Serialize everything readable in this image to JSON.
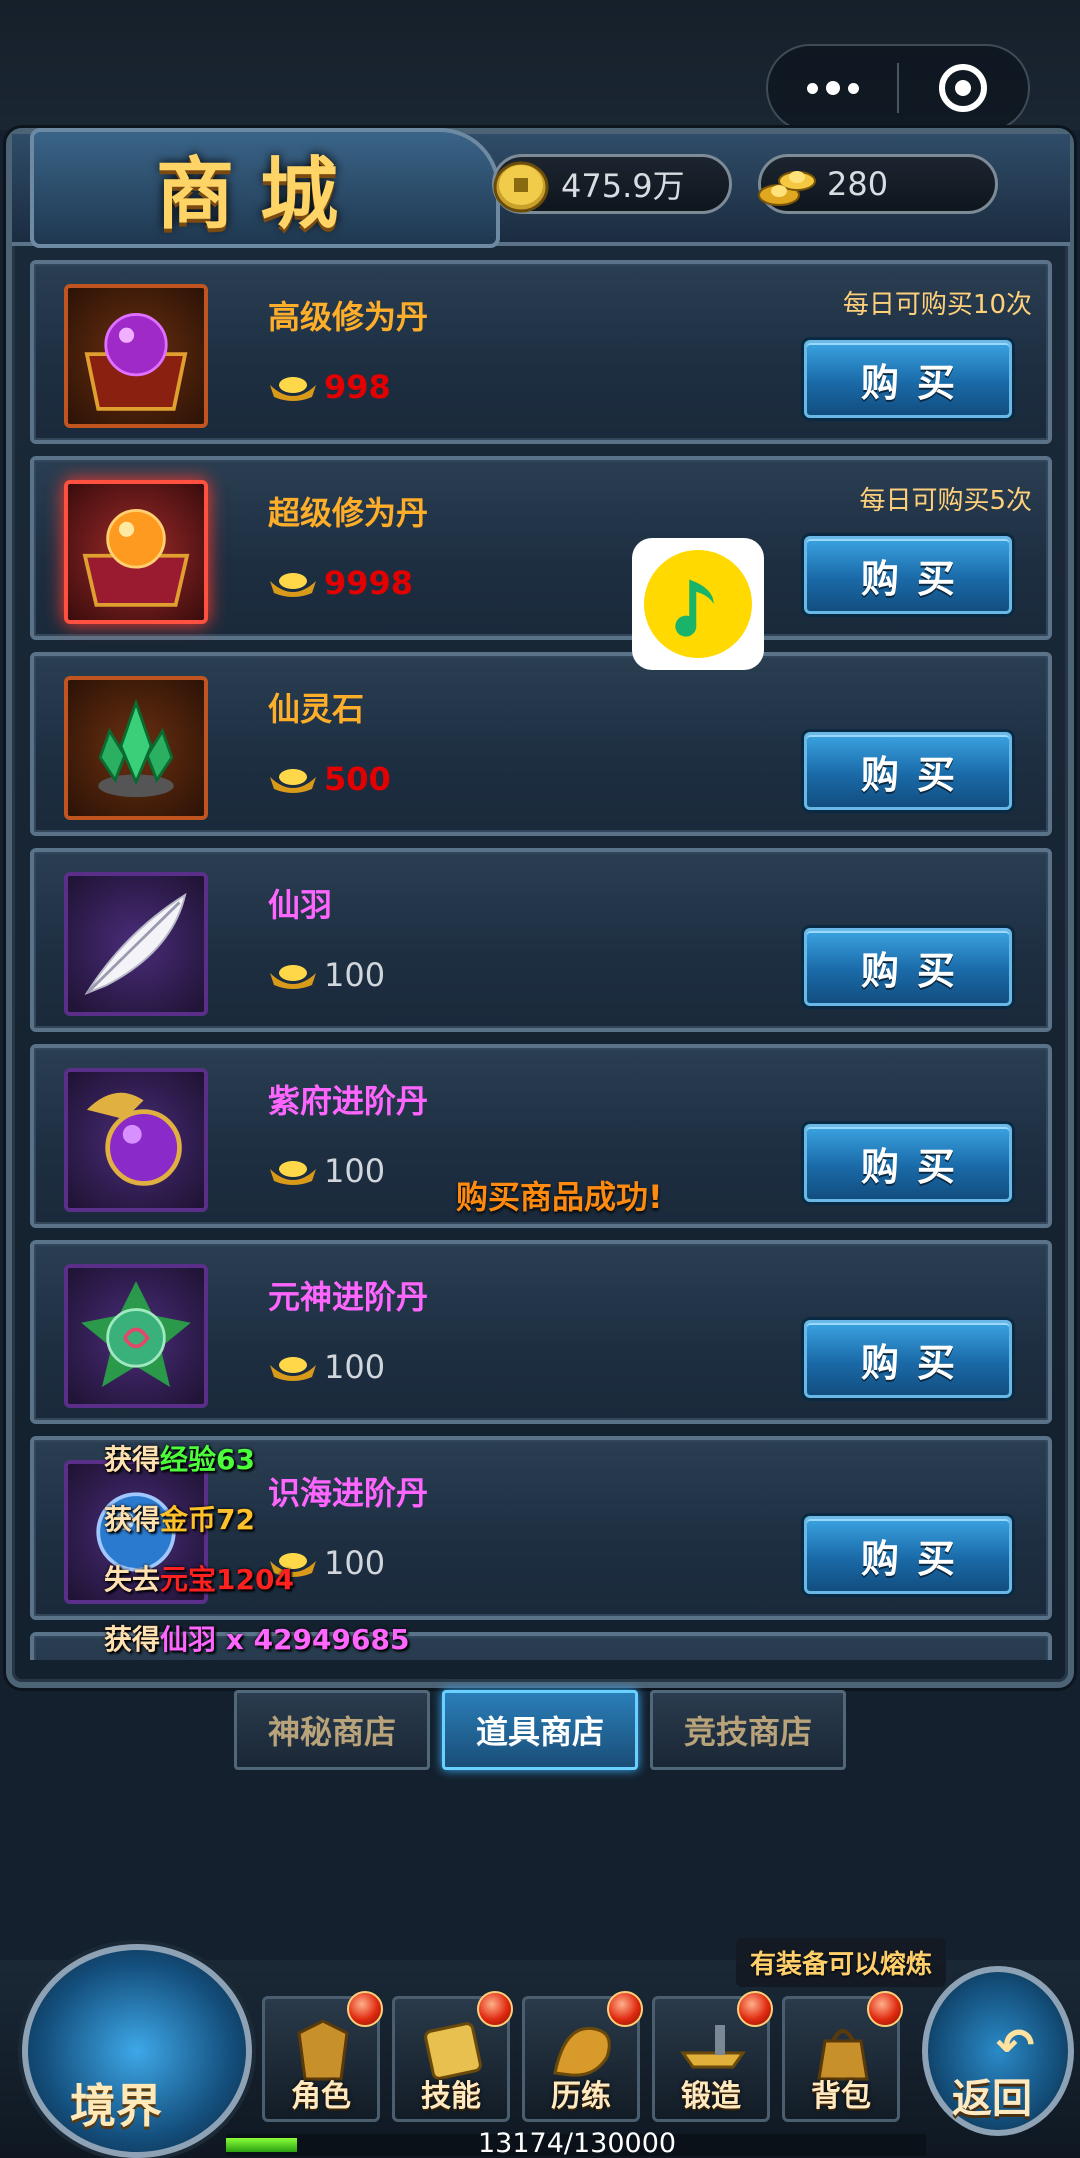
{
  "header": {
    "title": "商城",
    "copper": "475.9万",
    "gold": "280"
  },
  "items": [
    {
      "name": "高级修为丹",
      "price": "998",
      "limit": "每日可购买10次",
      "buy": "购买"
    },
    {
      "name": "超级修为丹",
      "price": "9998",
      "limit": "每日可购买5次",
      "buy": "购买"
    },
    {
      "name": "仙灵石",
      "price": "500",
      "buy": "购买"
    },
    {
      "name": "仙羽",
      "price": "100",
      "buy": "购买"
    },
    {
      "name": "紫府进阶丹",
      "price": "100",
      "buy": "购买"
    },
    {
      "name": "元神进阶丹",
      "price": "100",
      "buy": "购买"
    },
    {
      "name": "识海进阶丹",
      "price": "100",
      "buy": "购买"
    }
  ],
  "toast": "购买商品成功!",
  "log": [
    {
      "prefix": "获得",
      "text": "经验63"
    },
    {
      "prefix": "获得",
      "text": "金币72"
    },
    {
      "prefix": "失去",
      "text": "元宝1204"
    },
    {
      "prefix": "获得",
      "text": "仙羽 x 42949685"
    }
  ],
  "tabs": [
    "神秘商店",
    "道具商店",
    "竞技商店"
  ],
  "bottom": {
    "realm": "境界",
    "menu": [
      "角色",
      "技能",
      "历练",
      "锻造",
      "背包"
    ],
    "back": "返回",
    "hint": "有装备可以熔炼",
    "exp": "13174/130000",
    "exp_progress": 0.1013
  }
}
